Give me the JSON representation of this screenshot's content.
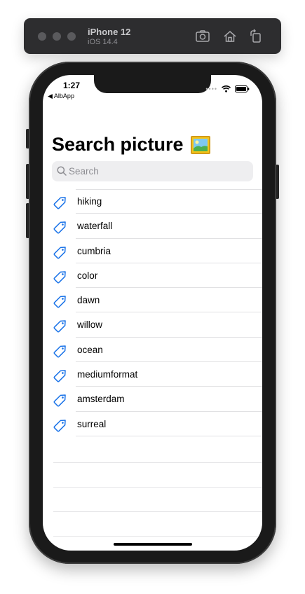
{
  "simulator": {
    "device_name": "iPhone 12",
    "os_version": "iOS 14.4"
  },
  "status_bar": {
    "time": "1:27",
    "back_app": "◀ AlbApp"
  },
  "page": {
    "title": "Search picture",
    "search_placeholder": "Search",
    "search_value": ""
  },
  "tags": [
    {
      "label": "hiking"
    },
    {
      "label": "waterfall"
    },
    {
      "label": "cumbria"
    },
    {
      "label": "color"
    },
    {
      "label": "dawn"
    },
    {
      "label": "willow"
    },
    {
      "label": "ocean"
    },
    {
      "label": "mediumformat"
    },
    {
      "label": "amsterdam"
    },
    {
      "label": "surreal"
    }
  ],
  "colors": {
    "accent": "#1a73e8",
    "search_background": "#eeeef0"
  },
  "icons": {
    "tag": "tag-icon",
    "search": "magnifier-icon",
    "title_emoji": "framed-picture-icon"
  }
}
